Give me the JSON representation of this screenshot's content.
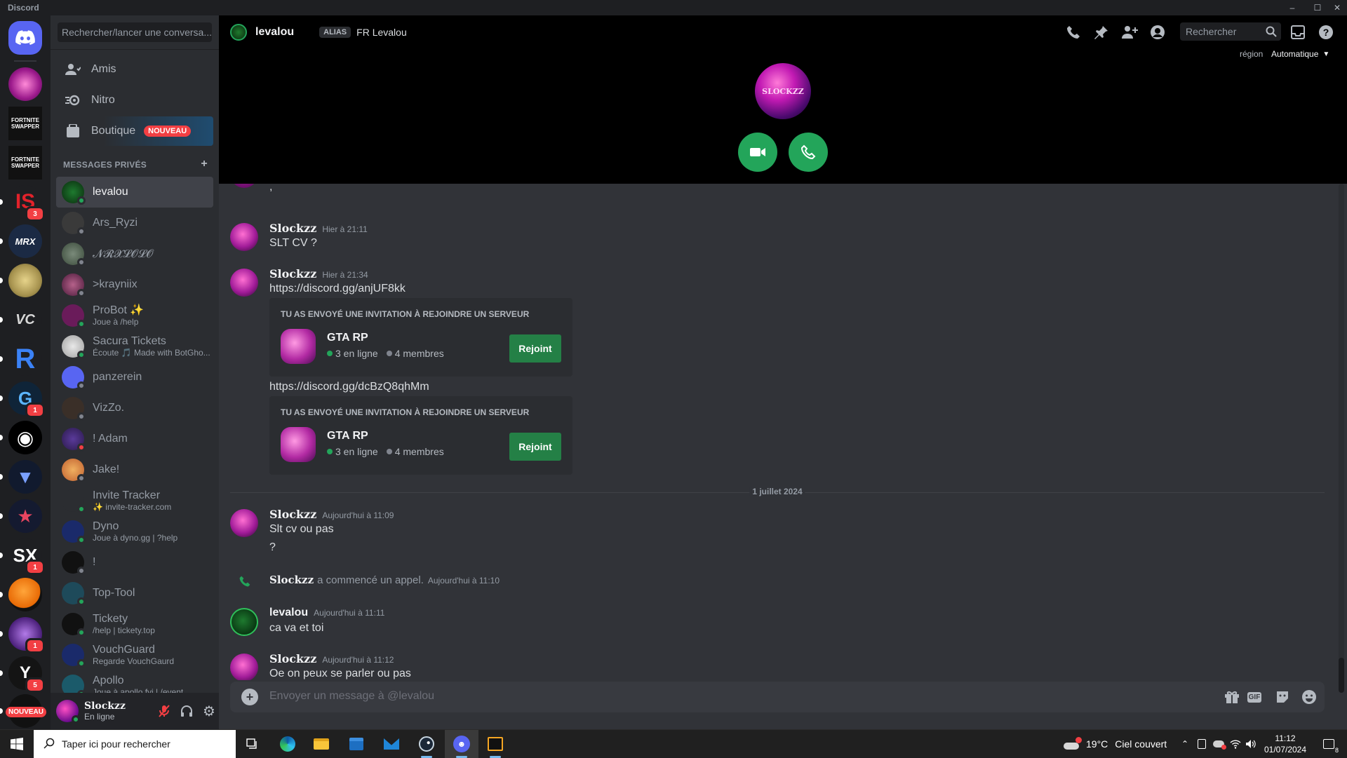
{
  "window": {
    "title": "Discord"
  },
  "colors": {
    "accent_green": "#23a55a",
    "blurple": "#5865f2",
    "danger": "#f23f43",
    "link": "#00a8fc"
  },
  "servers": [
    {
      "name": "discord-home-icon"
    },
    {
      "name": "server-gta-rp"
    },
    {
      "name": "server-fortnite-swapper-1",
      "text": "FORTNITE SWAPPER"
    },
    {
      "name": "server-fortnite-swapper-2",
      "text": "FORTNITE SWAPPER"
    },
    {
      "name": "server-is",
      "text": "IS",
      "badge": "3"
    },
    {
      "name": "server-mrx",
      "text": "MRX"
    },
    {
      "name": "server-map"
    },
    {
      "name": "server-vc",
      "text": "VC"
    },
    {
      "name": "server-r",
      "text": "R"
    },
    {
      "name": "server-g",
      "text": "G",
      "badge": "1"
    },
    {
      "name": "server-globe"
    },
    {
      "name": "server-v-shield"
    },
    {
      "name": "server-star-shield"
    },
    {
      "name": "server-sx",
      "text": "SX",
      "badge": "1"
    },
    {
      "name": "server-orange"
    },
    {
      "name": "server-wolf",
      "badge": "1"
    },
    {
      "name": "server-y",
      "text": "Y",
      "badge": "5"
    },
    {
      "name": "server-new",
      "text": "NOUVEAU"
    }
  ],
  "dm_sidebar": {
    "search_placeholder": "Rechercher/lancer une conversa...",
    "nav": {
      "friends": "Amis",
      "nitro": "Nitro",
      "shop": "Boutique",
      "shop_badge": "NOUVEAU"
    },
    "header": "MESSAGES PRIVÉS",
    "header_add": "+",
    "dms": [
      {
        "name": "levalou",
        "sub": "",
        "status": "online",
        "active": true
      },
      {
        "name": "Ars_Ryzi",
        "sub": "",
        "status": "offline"
      },
      {
        "name": "𝓝𝓡𝓧𝓛𝓞𝓛𝓞",
        "sub": "",
        "status": "offline"
      },
      {
        "name": ">krayniix",
        "sub": "",
        "status": "offline"
      },
      {
        "name": "ProBot ✨",
        "sub": "Joue à /help",
        "status": "online"
      },
      {
        "name": "Sacura Tickets",
        "sub": "Écoute 🎵 Made with BotGho...",
        "status": "online"
      },
      {
        "name": "panzerein",
        "sub": "",
        "status": "offline"
      },
      {
        "name": "VizZo.",
        "sub": "",
        "status": "offline"
      },
      {
        "name": "! Adam",
        "sub": "",
        "status": "dnd"
      },
      {
        "name": "Jake!",
        "sub": "",
        "status": "offline"
      },
      {
        "name": "Invite Tracker",
        "sub": "✨ invite-tracker.com",
        "status": "online"
      },
      {
        "name": "Dyno",
        "sub": "Joue à dyno.gg | ?help",
        "status": "online"
      },
      {
        "name": "!",
        "sub": "",
        "status": "offline"
      },
      {
        "name": "Top-Tool",
        "sub": "",
        "status": "online"
      },
      {
        "name": "Tickety",
        "sub": "/help | tickety.top",
        "status": "online"
      },
      {
        "name": "VouchGuard",
        "sub": "Regarde VouchGaurd",
        "status": "online"
      },
      {
        "name": "Apollo",
        "sub": "Joue à apollo.fyi | /event",
        "status": "online"
      }
    ]
  },
  "user": {
    "name": "Slockzz",
    "status": "En ligne"
  },
  "header": {
    "name": "levalou",
    "alias_tag": "ALIAS",
    "alias_value": "FR Levalou",
    "search_placeholder": "Rechercher",
    "region_label": "région",
    "region_value": "Automatique"
  },
  "call": {
    "avatar_text": "SLOCKZZ"
  },
  "messages": {
    "m1": {
      "author": "Slockzz",
      "time": "Hier à 21:11",
      "text": "SLT CV ?"
    },
    "m2": {
      "author": "Slockzz",
      "time": "Hier à 21:34",
      "link1": "https://discord.gg/anjUF8kk",
      "link2": "https://discord.gg/dcBzQ8qhMm"
    },
    "invite": {
      "title": "TU AS ENVOYÉ UNE INVITATION À REJOINDRE UN SERVEUR",
      "server": "GTA RP",
      "online": "3 en ligne",
      "members": "4 membres",
      "button": "Rejoint"
    },
    "date_sep": "1 juillet 2024",
    "m3": {
      "author": "Slockzz",
      "time": "Aujourd'hui à 11:09",
      "text1": "Slt cv ou pas",
      "text2": "?"
    },
    "call_event": {
      "author": "Slockzz",
      "text": "a commencé un appel.",
      "time": "Aujourd'hui à 11:10"
    },
    "m4": {
      "author": "levalou",
      "time": "Aujourd'hui à 11:11",
      "text": "ca va et toi"
    },
    "m5": {
      "author": "Slockzz",
      "time": "Aujourd'hui à 11:12",
      "text": "Oe on peux se parler ou pas"
    }
  },
  "composer": {
    "placeholder": "Envoyer un message à @levalou",
    "gif": "GIF"
  },
  "taskbar": {
    "search_placeholder": "Taper ici pour rechercher",
    "weather_temp": "19°C",
    "weather_desc": "Ciel couvert",
    "time": "11:12",
    "date": "01/07/2024",
    "notif_count": "8"
  }
}
